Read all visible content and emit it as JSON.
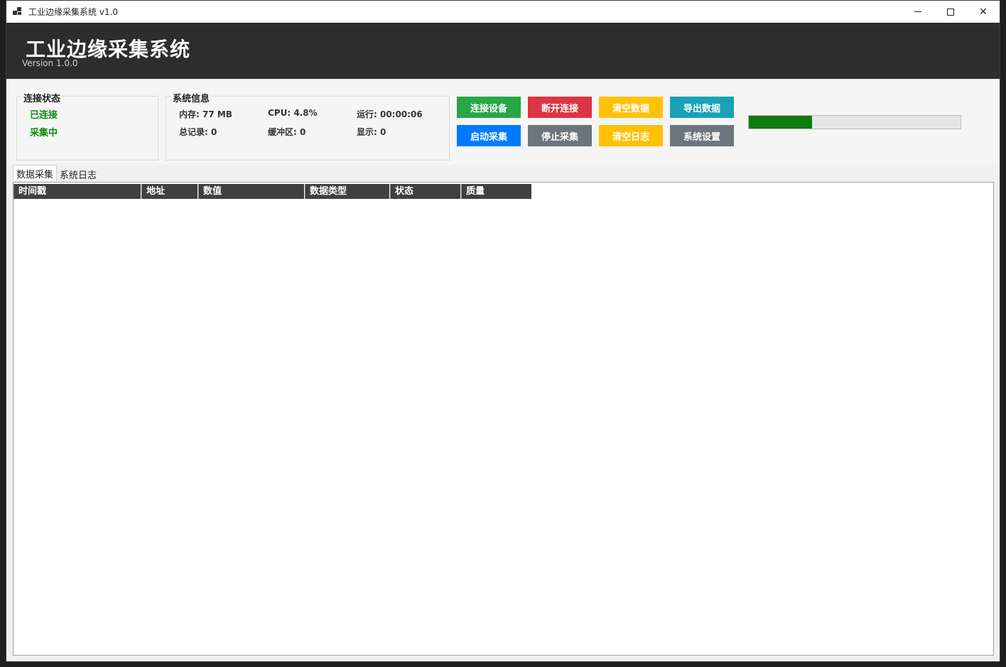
{
  "window": {
    "title": "工业边缘采集系统 v1.0"
  },
  "header": {
    "title": "工业边缘采集系统",
    "version": "Version 1.0.0"
  },
  "connection": {
    "legend": "连接状态",
    "status1": "已连接",
    "status2": "采集中"
  },
  "sysinfo": {
    "legend": "系统信息",
    "memory": "内存: 77 MB",
    "cpu": "CPU: 4.8%",
    "runtime": "运行: 00:00:06",
    "total": "总记录: 0",
    "buffer": "缓冲区: 0",
    "display": "显示: 0"
  },
  "buttons": {
    "connect": {
      "label": "连接设备",
      "color": "#28a745"
    },
    "disconnect": {
      "label": "断开连接",
      "color": "#dc3545"
    },
    "clear_data": {
      "label": "清空数据",
      "color": "#ffc107"
    },
    "export": {
      "label": "导出数据",
      "color": "#17a2b8"
    },
    "start": {
      "label": "启动采集",
      "color": "#007bff"
    },
    "stop": {
      "label": "停止采集",
      "color": "#6c757d"
    },
    "clear_log": {
      "label": "清空日志",
      "color": "#ffc107"
    },
    "settings": {
      "label": "系统设置",
      "color": "#6c757d"
    }
  },
  "progress": {
    "value_percent": 30
  },
  "tabs": [
    {
      "label": "数据采集"
    },
    {
      "label": "系统日志"
    }
  ],
  "grid": {
    "columns": [
      "时间戳",
      "地址",
      "数值",
      "数据类型",
      "状态",
      "质量"
    ]
  }
}
